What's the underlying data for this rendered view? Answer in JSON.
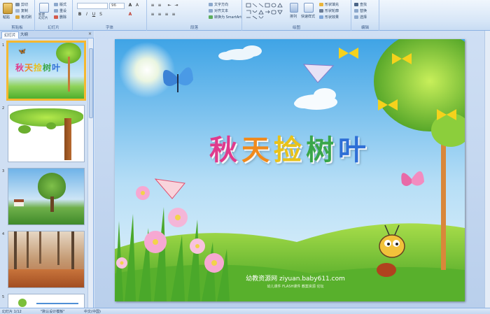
{
  "ribbon": {
    "clipboard": {
      "label": "剪贴板",
      "paste": "粘贴",
      "cut": "剪切",
      "copy": "复制",
      "format_painter": "格式刷"
    },
    "slides": {
      "label": "幻灯片",
      "new_slide": "新建\n幻灯片",
      "layout": "版式",
      "reset": "重设",
      "delete": "删除"
    },
    "font": {
      "label": "字体",
      "size": "96"
    },
    "paragraph": {
      "label": "段落",
      "text_direction": "文字方向",
      "align_text": "对齐文本",
      "smartart": "转换为 SmartArt"
    },
    "drawing": {
      "label": "绘图",
      "arrange": "排列",
      "quick_styles": "快速样式",
      "shape_fill": "形状填充",
      "shape_outline": "形状轮廓",
      "shape_effects": "形状效果"
    },
    "editing": {
      "label": "编辑",
      "find": "查找",
      "replace": "替换",
      "select": "选择"
    }
  },
  "panel": {
    "tabs": [
      "幻灯片",
      "大纲"
    ],
    "close": "×",
    "thumbnails": [
      {
        "number": "1",
        "title": "秋天捡树叶"
      },
      {
        "number": "2"
      },
      {
        "number": "3"
      },
      {
        "number": "4"
      },
      {
        "number": "5"
      }
    ]
  },
  "slide": {
    "title_chars": [
      "秋",
      "天",
      "捡",
      "树",
      "叶"
    ],
    "title_colors": [
      "#e03a8c",
      "#f08a1c",
      "#e8c21a",
      "#3aa64a",
      "#2f6fd6"
    ],
    "watermark": "幼教资源网 ziyuan.baby611.com",
    "watermark_sub": "幼儿课件  FLASH课件  教案资源  论坛"
  },
  "status": {
    "slide_info": "幻灯片 1/12",
    "theme": "\"默认设计模板\"",
    "language": "中文(中国)"
  }
}
